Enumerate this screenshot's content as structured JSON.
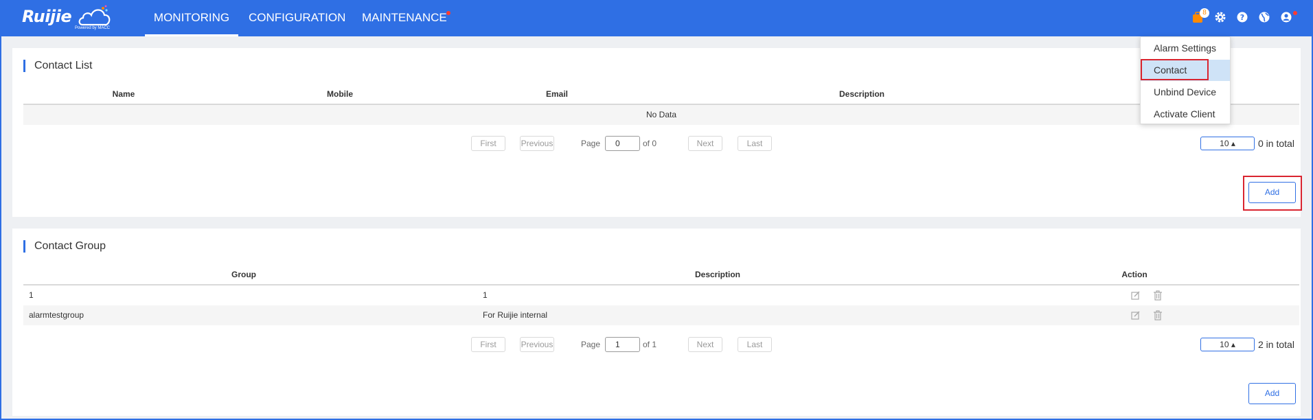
{
  "header": {
    "logo_text": "Ruijie",
    "logo_sub": "Powered by MACC",
    "nav": [
      "MONITORING",
      "CONFIGURATION",
      "MAINTENANCE"
    ],
    "active_nav": "MONITORING",
    "notification_count": "8",
    "icons": [
      "notification-icon",
      "gear-icon",
      "help-icon",
      "globe-icon",
      "user-icon"
    ]
  },
  "dropdown": {
    "items": [
      "Alarm Settings",
      "Contact",
      "Unbind Device",
      "Activate Client"
    ],
    "selected": "Contact"
  },
  "contact_list": {
    "title": "Contact List",
    "columns": [
      "Name",
      "Mobile",
      "Email",
      "Description"
    ],
    "empty_text": "No Data",
    "pagination": {
      "first": "First",
      "previous": "Previous",
      "page_label": "Page",
      "page_value": "0",
      "of_text": "of 0",
      "next": "Next",
      "last": "Last",
      "page_size": "10 ▴",
      "total": "0 in total"
    },
    "add_label": "Add"
  },
  "contact_group": {
    "title": "Contact Group",
    "columns": [
      "Group",
      "Description",
      "Action"
    ],
    "rows": [
      {
        "group": "1",
        "description": "1"
      },
      {
        "group": "alarmtestgroup",
        "description": "For Ruijie internal"
      }
    ],
    "pagination": {
      "first": "First",
      "previous": "Previous",
      "page_label": "Page",
      "page_value": "1",
      "of_text": "of 1",
      "next": "Next",
      "last": "Last",
      "page_size": "10 ▴",
      "total": "2 in total"
    },
    "add_label": "Add"
  },
  "colors": {
    "brand_blue": "#2f6fe4",
    "highlight_red": "#d9242f",
    "selected_bg": "#cfe3f7",
    "badge_orange": "#ff8a00"
  }
}
